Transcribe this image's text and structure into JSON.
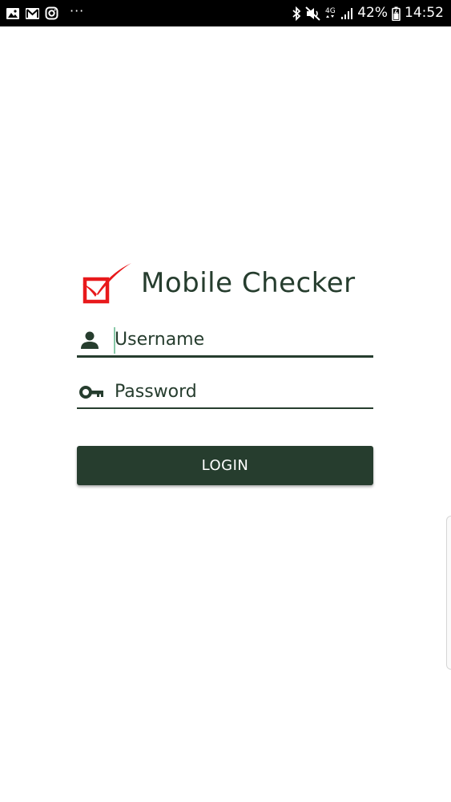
{
  "status_bar": {
    "left_icons": [
      "gallery-icon",
      "gmail-icon",
      "instagram-icon"
    ],
    "more": "···",
    "right_icons": [
      "bluetooth-icon",
      "mute-icon",
      "network-4g-icon",
      "signal-icon",
      "battery-icon"
    ],
    "network_label": "4G",
    "battery_percent": "42%",
    "time": "14:52"
  },
  "app": {
    "title": "Mobile Checker",
    "logo_color": "#e8191b",
    "accent": "#263d2e"
  },
  "form": {
    "username_placeholder": "Username",
    "password_placeholder": "Password",
    "login_label": "LOGIN"
  }
}
